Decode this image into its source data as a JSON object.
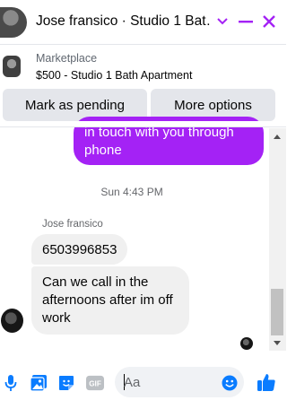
{
  "header": {
    "title": "Jose fransico · Studio 1 Bat…",
    "icons": [
      "chevron-down-icon",
      "minimize-icon",
      "close-icon"
    ],
    "accent_color": "#a422f5"
  },
  "marketplace": {
    "label": "Marketplace",
    "listing": "$500 - Studio 1 Bath Apartment",
    "buttons": {
      "pending": "Mark as pending",
      "more": "More options"
    }
  },
  "messages": {
    "outgoing_line1": "in touch with you through",
    "outgoing_line2": "phone",
    "timestamp": "Sun 4:43 PM",
    "sender": "Jose fransico",
    "incoming": [
      "6503996853",
      "Can we call in the afternoons after im off work"
    ]
  },
  "composer": {
    "placeholder": "Aa",
    "icons": [
      "microphone-icon",
      "photo-icon",
      "sticker-icon",
      "gif-icon",
      "emoji-icon",
      "like-icon"
    ]
  }
}
